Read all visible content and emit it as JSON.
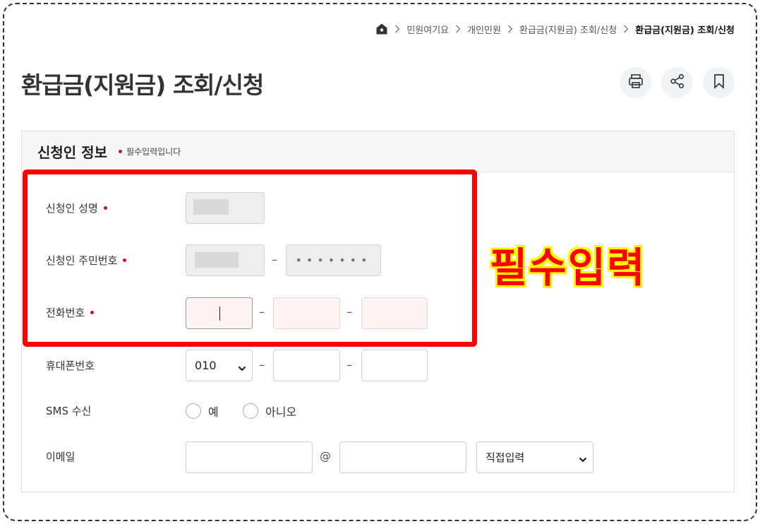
{
  "breadcrumb": {
    "items": [
      "민원여기요",
      "개인민원",
      "환급금(지원금) 조회/신청"
    ],
    "current": "환급금(지원금) 조회/신청"
  },
  "page": {
    "title": "환급금(지원금) 조회/신청"
  },
  "actions": {
    "icons": [
      "printer-icon",
      "share-icon",
      "bookmark-icon"
    ]
  },
  "form": {
    "section_title": "신청인 정보",
    "required_note": "필수입력입니다",
    "fields": {
      "name": {
        "label": "신청인 성명"
      },
      "resident_no": {
        "label": "신청인 주민번호",
        "back_masked": "•••••••"
      },
      "phone": {
        "label": "전화번호"
      },
      "mobile": {
        "label": "휴대폰번호",
        "prefix_selected": "010"
      },
      "sms": {
        "label": "SMS 수신",
        "options": [
          "예",
          "아니오"
        ]
      },
      "email": {
        "label": "이메일",
        "at": "@",
        "domain_selected": "직접입력"
      }
    },
    "separator": "–"
  },
  "annotation": {
    "text": "필수입력",
    "highlight_color": "#fe0000",
    "text_color": "#ff0000",
    "outline_color": "#fff700"
  }
}
